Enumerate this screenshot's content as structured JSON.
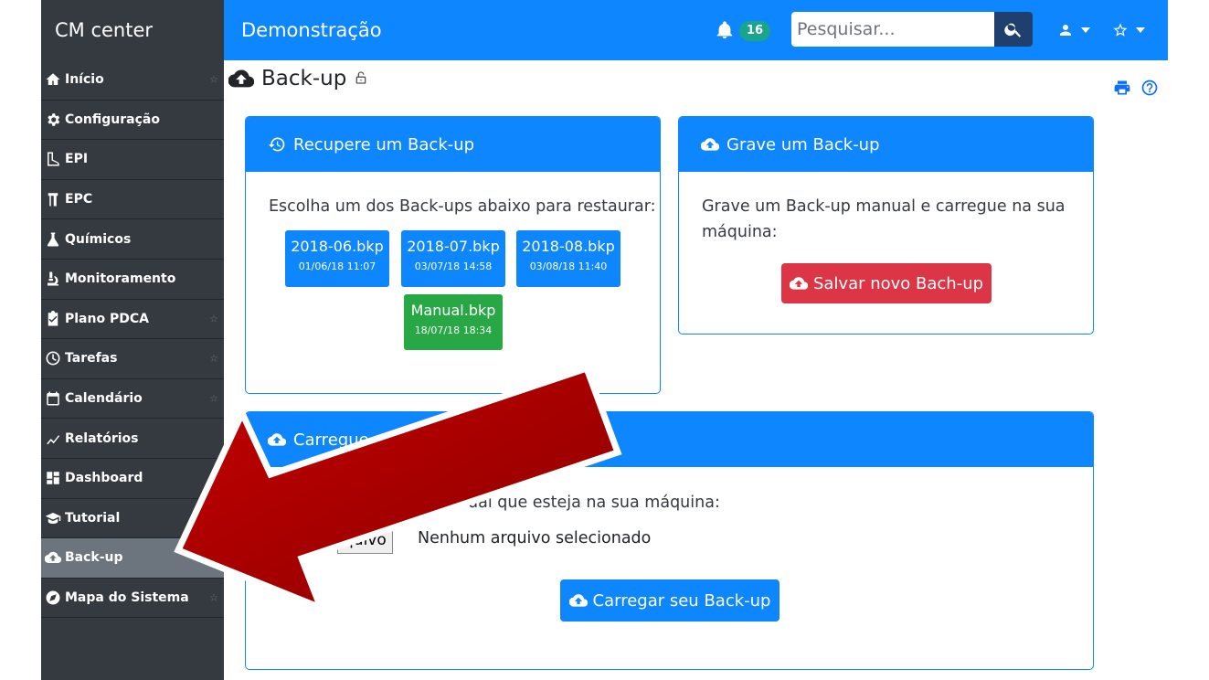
{
  "sidebar": {
    "brand": "CM center",
    "items": [
      {
        "label": "Início",
        "icon": "home-icon",
        "star": true
      },
      {
        "label": "Configuração",
        "icon": "gear-icon",
        "star": false
      },
      {
        "label": "EPI",
        "icon": "boot-icon",
        "star": false
      },
      {
        "label": "EPC",
        "icon": "cone-icon",
        "star": false
      },
      {
        "label": "Químicos",
        "icon": "flask-icon",
        "star": false
      },
      {
        "label": "Monitoramento",
        "icon": "microscope-icon",
        "star": false
      },
      {
        "label": "Plano PDCA",
        "icon": "clipboard-check-icon",
        "star": true
      },
      {
        "label": "Tarefas",
        "icon": "clock-icon",
        "star": true
      },
      {
        "label": "Calendário",
        "icon": "calendar-icon",
        "star": true
      },
      {
        "label": "Relatórios",
        "icon": "line-chart-icon",
        "star": false
      },
      {
        "label": "Dashboard",
        "icon": "dashboard-icon",
        "star": true
      },
      {
        "label": "Tutorial",
        "icon": "graduation-cap-icon",
        "star": false
      },
      {
        "label": "Back-up",
        "icon": "cloud-upload-icon",
        "star": false,
        "active": true
      },
      {
        "label": "Mapa do Sistema",
        "icon": "compass-icon",
        "star": true
      }
    ],
    "star_glyph": "☆"
  },
  "topbar": {
    "title": "Demonstração",
    "notification_count": "16",
    "search_placeholder": "Pesquisar..."
  },
  "page": {
    "title": "Back-up"
  },
  "restore_card": {
    "title": "Recupere um Back-up",
    "instruction": "Escolha um dos Back-ups abaixo para restaurar:",
    "backups": [
      {
        "name": "2018-06.bkp",
        "date": "01/06/18 11:07",
        "type": "auto"
      },
      {
        "name": "2018-07.bkp",
        "date": "03/07/18 14:58",
        "type": "auto"
      },
      {
        "name": "2018-08.bkp",
        "date": "03/08/18 11:40",
        "type": "auto"
      },
      {
        "name": "Manual.bkp",
        "date": "18/07/18 18:34",
        "type": "manual"
      }
    ]
  },
  "save_card": {
    "title": "Grave um Back-up",
    "instruction": "Grave um Back-up manual e carregue na sua máquina:",
    "button": "Salvar novo Bach-up"
  },
  "upload_card": {
    "title": "Carregue",
    "instruction_visible": "ual que esteja na sua máquina:",
    "file_button_visible": "quivo",
    "file_status": "Nenhum arquivo selecionado",
    "button": "Carregar seu Back-up"
  },
  "colors": {
    "primary": "#0d86fe",
    "sidebar": "#343a40",
    "danger": "#dc3545",
    "success": "#28a745",
    "arrow": "#b00000"
  }
}
